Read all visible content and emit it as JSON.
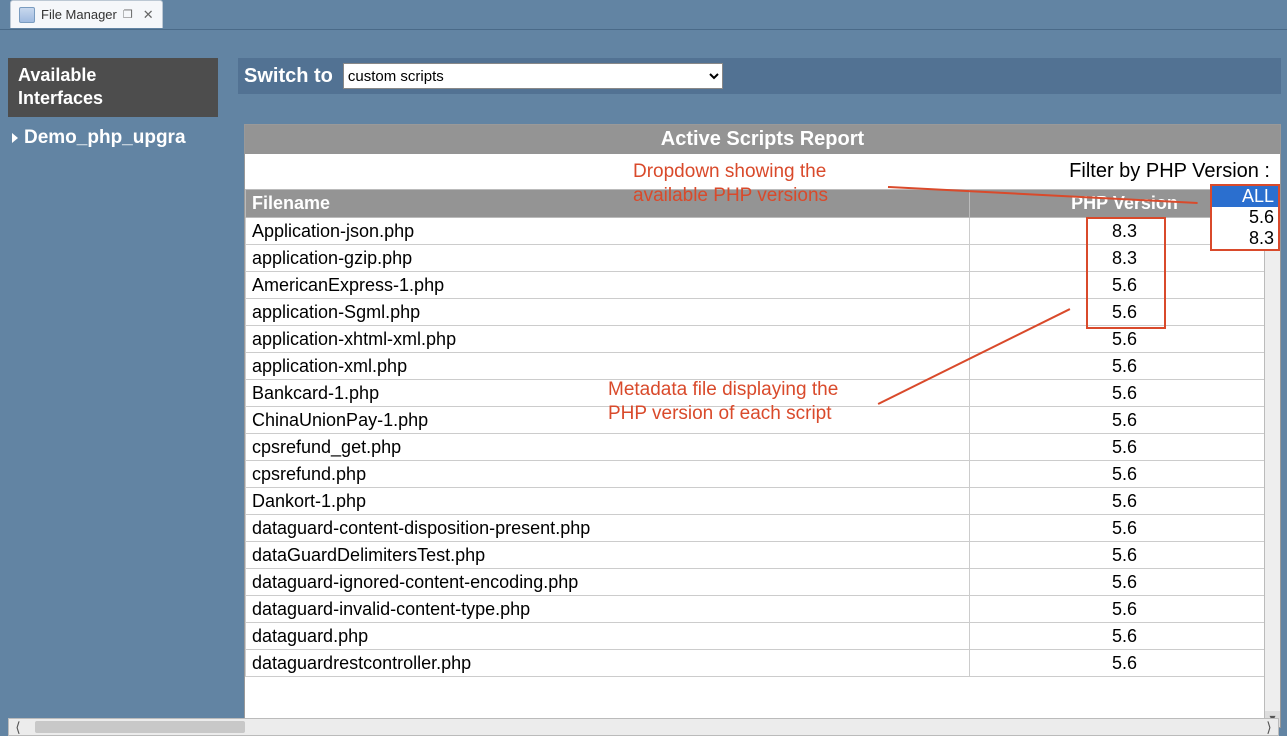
{
  "tab": {
    "title": "File Manager"
  },
  "sidebar": {
    "header_l1": "Available",
    "header_l2": "Interfaces",
    "tree_item": "Demo_php_upgra"
  },
  "switch": {
    "label": "Switch to",
    "selected": "custom scripts"
  },
  "report": {
    "title": "Active Scripts Report",
    "filter_label": "Filter by PHP Version :",
    "dropdown": {
      "options": [
        "ALL",
        "5.6",
        "8.3"
      ],
      "selected": "ALL"
    },
    "columns": {
      "filename": "Filename",
      "version": "PHP Version"
    },
    "rows": [
      {
        "filename": "Application-json.php",
        "version": "8.3"
      },
      {
        "filename": "application-gzip.php",
        "version": "8.3"
      },
      {
        "filename": "AmericanExpress-1.php",
        "version": "5.6"
      },
      {
        "filename": "application-Sgml.php",
        "version": "5.6"
      },
      {
        "filename": "application-xhtml-xml.php",
        "version": "5.6"
      },
      {
        "filename": "application-xml.php",
        "version": "5.6"
      },
      {
        "filename": "Bankcard-1.php",
        "version": "5.6"
      },
      {
        "filename": "ChinaUnionPay-1.php",
        "version": "5.6"
      },
      {
        "filename": "cpsrefund_get.php",
        "version": "5.6"
      },
      {
        "filename": "cpsrefund.php",
        "version": "5.6"
      },
      {
        "filename": "Dankort-1.php",
        "version": "5.6"
      },
      {
        "filename": "dataguard-content-disposition-present.php",
        "version": "5.6"
      },
      {
        "filename": "dataGuardDelimitersTest.php",
        "version": "5.6"
      },
      {
        "filename": "dataguard-ignored-content-encoding.php",
        "version": "5.6"
      },
      {
        "filename": "dataguard-invalid-content-type.php",
        "version": "5.6"
      },
      {
        "filename": "dataguard.php",
        "version": "5.6"
      },
      {
        "filename": "dataguardrestcontroller.php",
        "version": "5.6"
      }
    ]
  },
  "annotations": {
    "dropdown_note_l1": "Dropdown showing the",
    "dropdown_note_l2": "available PHP versions",
    "metadata_note_l1": "Metadata file displaying the",
    "metadata_note_l2": "PHP version of each script"
  }
}
